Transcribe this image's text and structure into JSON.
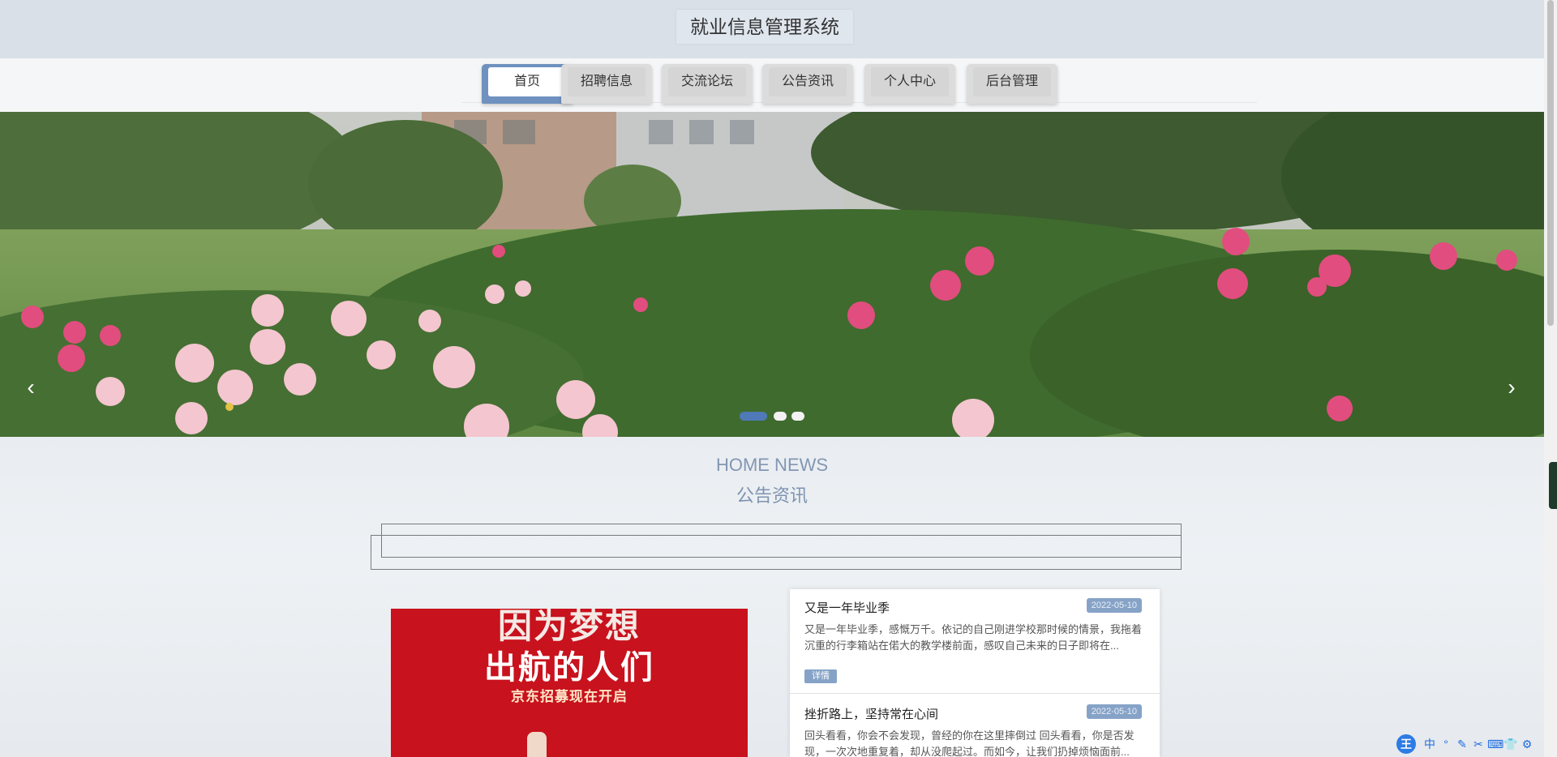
{
  "header": {
    "title": "就业信息管理系统"
  },
  "nav": {
    "items": [
      {
        "label": "首页",
        "active": true
      },
      {
        "label": "招聘信息",
        "active": false
      },
      {
        "label": "交流论坛",
        "active": false
      },
      {
        "label": "公告资讯",
        "active": false
      },
      {
        "label": "个人中心",
        "active": false
      },
      {
        "label": "后台管理",
        "active": false
      }
    ]
  },
  "banner": {
    "slide_count": 3,
    "active_slide": 1,
    "prev_glyph": "‹",
    "next_glyph": "›"
  },
  "section": {
    "heading_en": "HOME NEWS",
    "heading_cn": "公告资讯"
  },
  "feature": {
    "line1": "因为梦想",
    "line2": "出航的人们",
    "line3": "京东招募现在开启"
  },
  "news": [
    {
      "title": "又是一年毕业季",
      "date": "2022-05-10",
      "excerpt": "又是一年毕业季，感慨万千。依记的自己刚进学校那时候的情景，我拖着沉重的行李箱站在偌大的教学楼前面，感叹自己未来的日子即将在...",
      "more_label": "详情"
    },
    {
      "title": "挫折路上，坚持常在心间",
      "date": "2022-05-10",
      "excerpt": "回头看看，你会不会发现，曾经的你在这里摔倒过 回头看看，你是否发现，一次次地重复着，却从没爬起过。而如今，让我们扔掉烦恼面前..."
    }
  ],
  "ime": {
    "logo": "王",
    "items": [
      "中",
      "°",
      "✎",
      "✂",
      "⌨",
      "👕",
      "⚙"
    ]
  },
  "colors": {
    "nav_active": "#6f91bf",
    "accent": "#86a3c7",
    "feature_bg": "#c8121d"
  }
}
